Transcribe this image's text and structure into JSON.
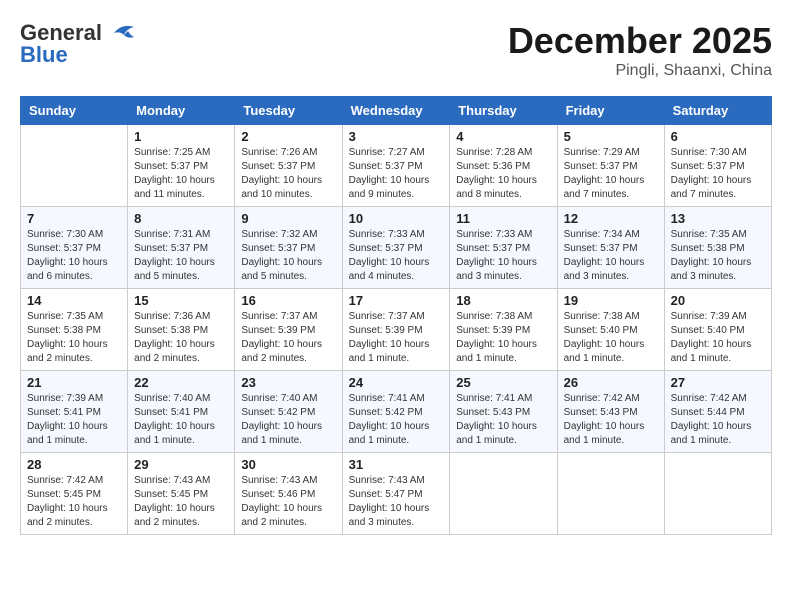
{
  "header": {
    "logo_general": "General",
    "logo_blue": "Blue",
    "title": "December 2025",
    "subtitle": "Pingli, Shaanxi, China"
  },
  "days_of_week": [
    "Sunday",
    "Monday",
    "Tuesday",
    "Wednesday",
    "Thursday",
    "Friday",
    "Saturday"
  ],
  "weeks": [
    [
      {
        "day": "",
        "info": ""
      },
      {
        "day": "1",
        "info": "Sunrise: 7:25 AM\nSunset: 5:37 PM\nDaylight: 10 hours\nand 11 minutes."
      },
      {
        "day": "2",
        "info": "Sunrise: 7:26 AM\nSunset: 5:37 PM\nDaylight: 10 hours\nand 10 minutes."
      },
      {
        "day": "3",
        "info": "Sunrise: 7:27 AM\nSunset: 5:37 PM\nDaylight: 10 hours\nand 9 minutes."
      },
      {
        "day": "4",
        "info": "Sunrise: 7:28 AM\nSunset: 5:36 PM\nDaylight: 10 hours\nand 8 minutes."
      },
      {
        "day": "5",
        "info": "Sunrise: 7:29 AM\nSunset: 5:37 PM\nDaylight: 10 hours\nand 7 minutes."
      },
      {
        "day": "6",
        "info": "Sunrise: 7:30 AM\nSunset: 5:37 PM\nDaylight: 10 hours\nand 7 minutes."
      }
    ],
    [
      {
        "day": "7",
        "info": "Sunrise: 7:30 AM\nSunset: 5:37 PM\nDaylight: 10 hours\nand 6 minutes."
      },
      {
        "day": "8",
        "info": "Sunrise: 7:31 AM\nSunset: 5:37 PM\nDaylight: 10 hours\nand 5 minutes."
      },
      {
        "day": "9",
        "info": "Sunrise: 7:32 AM\nSunset: 5:37 PM\nDaylight: 10 hours\nand 5 minutes."
      },
      {
        "day": "10",
        "info": "Sunrise: 7:33 AM\nSunset: 5:37 PM\nDaylight: 10 hours\nand 4 minutes."
      },
      {
        "day": "11",
        "info": "Sunrise: 7:33 AM\nSunset: 5:37 PM\nDaylight: 10 hours\nand 3 minutes."
      },
      {
        "day": "12",
        "info": "Sunrise: 7:34 AM\nSunset: 5:37 PM\nDaylight: 10 hours\nand 3 minutes."
      },
      {
        "day": "13",
        "info": "Sunrise: 7:35 AM\nSunset: 5:38 PM\nDaylight: 10 hours\nand 3 minutes."
      }
    ],
    [
      {
        "day": "14",
        "info": "Sunrise: 7:35 AM\nSunset: 5:38 PM\nDaylight: 10 hours\nand 2 minutes."
      },
      {
        "day": "15",
        "info": "Sunrise: 7:36 AM\nSunset: 5:38 PM\nDaylight: 10 hours\nand 2 minutes."
      },
      {
        "day": "16",
        "info": "Sunrise: 7:37 AM\nSunset: 5:39 PM\nDaylight: 10 hours\nand 2 minutes."
      },
      {
        "day": "17",
        "info": "Sunrise: 7:37 AM\nSunset: 5:39 PM\nDaylight: 10 hours\nand 1 minute."
      },
      {
        "day": "18",
        "info": "Sunrise: 7:38 AM\nSunset: 5:39 PM\nDaylight: 10 hours\nand 1 minute."
      },
      {
        "day": "19",
        "info": "Sunrise: 7:38 AM\nSunset: 5:40 PM\nDaylight: 10 hours\nand 1 minute."
      },
      {
        "day": "20",
        "info": "Sunrise: 7:39 AM\nSunset: 5:40 PM\nDaylight: 10 hours\nand 1 minute."
      }
    ],
    [
      {
        "day": "21",
        "info": "Sunrise: 7:39 AM\nSunset: 5:41 PM\nDaylight: 10 hours\nand 1 minute."
      },
      {
        "day": "22",
        "info": "Sunrise: 7:40 AM\nSunset: 5:41 PM\nDaylight: 10 hours\nand 1 minute."
      },
      {
        "day": "23",
        "info": "Sunrise: 7:40 AM\nSunset: 5:42 PM\nDaylight: 10 hours\nand 1 minute."
      },
      {
        "day": "24",
        "info": "Sunrise: 7:41 AM\nSunset: 5:42 PM\nDaylight: 10 hours\nand 1 minute."
      },
      {
        "day": "25",
        "info": "Sunrise: 7:41 AM\nSunset: 5:43 PM\nDaylight: 10 hours\nand 1 minute."
      },
      {
        "day": "26",
        "info": "Sunrise: 7:42 AM\nSunset: 5:43 PM\nDaylight: 10 hours\nand 1 minute."
      },
      {
        "day": "27",
        "info": "Sunrise: 7:42 AM\nSunset: 5:44 PM\nDaylight: 10 hours\nand 1 minute."
      }
    ],
    [
      {
        "day": "28",
        "info": "Sunrise: 7:42 AM\nSunset: 5:45 PM\nDaylight: 10 hours\nand 2 minutes."
      },
      {
        "day": "29",
        "info": "Sunrise: 7:43 AM\nSunset: 5:45 PM\nDaylight: 10 hours\nand 2 minutes."
      },
      {
        "day": "30",
        "info": "Sunrise: 7:43 AM\nSunset: 5:46 PM\nDaylight: 10 hours\nand 2 minutes."
      },
      {
        "day": "31",
        "info": "Sunrise: 7:43 AM\nSunset: 5:47 PM\nDaylight: 10 hours\nand 3 minutes."
      },
      {
        "day": "",
        "info": ""
      },
      {
        "day": "",
        "info": ""
      },
      {
        "day": "",
        "info": ""
      }
    ]
  ]
}
